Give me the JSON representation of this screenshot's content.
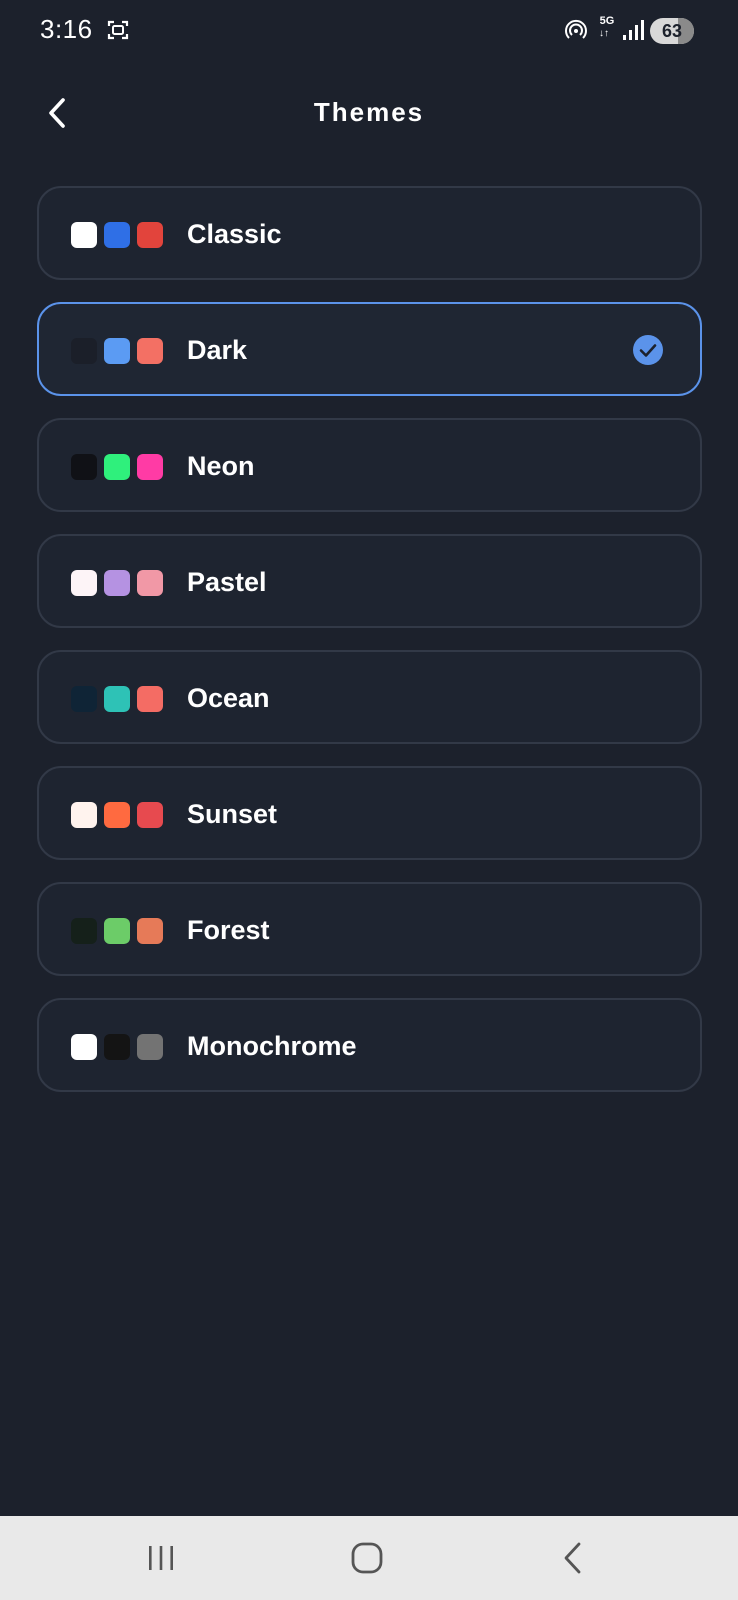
{
  "status_bar": {
    "time": "3:16",
    "network": "5G",
    "network_arrows": "↓↑",
    "battery": "63",
    "battery_level": 0.63,
    "icons": [
      "screenshot-icon",
      "hotspot-icon",
      "signal-icon",
      "battery-icon"
    ]
  },
  "header": {
    "title": "Themes",
    "back_icon": "chevron-left-icon"
  },
  "themes": [
    {
      "name": "Classic",
      "colors": [
        "#ffffff",
        "#2f6fe6",
        "#e2443c"
      ],
      "selected": false
    },
    {
      "name": "Dark",
      "colors": [
        "#1b1f29",
        "#5b9bf3",
        "#f37064"
      ],
      "selected": true
    },
    {
      "name": "Neon",
      "colors": [
        "#101116",
        "#2ff07c",
        "#ff3ba5"
      ],
      "selected": false
    },
    {
      "name": "Pastel",
      "colors": [
        "#fdf4f7",
        "#b592e2",
        "#f198a6"
      ],
      "selected": false
    },
    {
      "name": "Ocean",
      "colors": [
        "#0f2436",
        "#2ec2b6",
        "#f46c64"
      ],
      "selected": false
    },
    {
      "name": "Sunset",
      "colors": [
        "#fff3ee",
        "#ff6a40",
        "#e74a4f"
      ],
      "selected": false
    },
    {
      "name": "Forest",
      "colors": [
        "#15201a",
        "#6ccc68",
        "#e67a58"
      ],
      "selected": false
    },
    {
      "name": "Monochrome",
      "colors": [
        "#ffffff",
        "#141414",
        "#737373"
      ],
      "selected": false
    }
  ],
  "selected_icon": "check-circle-icon",
  "colors": {
    "background": "#1c212c",
    "card": "#1e2430",
    "card_border": "#323947",
    "accent": "#5b93ea",
    "nav_bar": "#e9e9e9"
  },
  "nav_bar": {
    "icons": [
      "recent-apps-icon",
      "home-icon",
      "back-icon"
    ]
  }
}
